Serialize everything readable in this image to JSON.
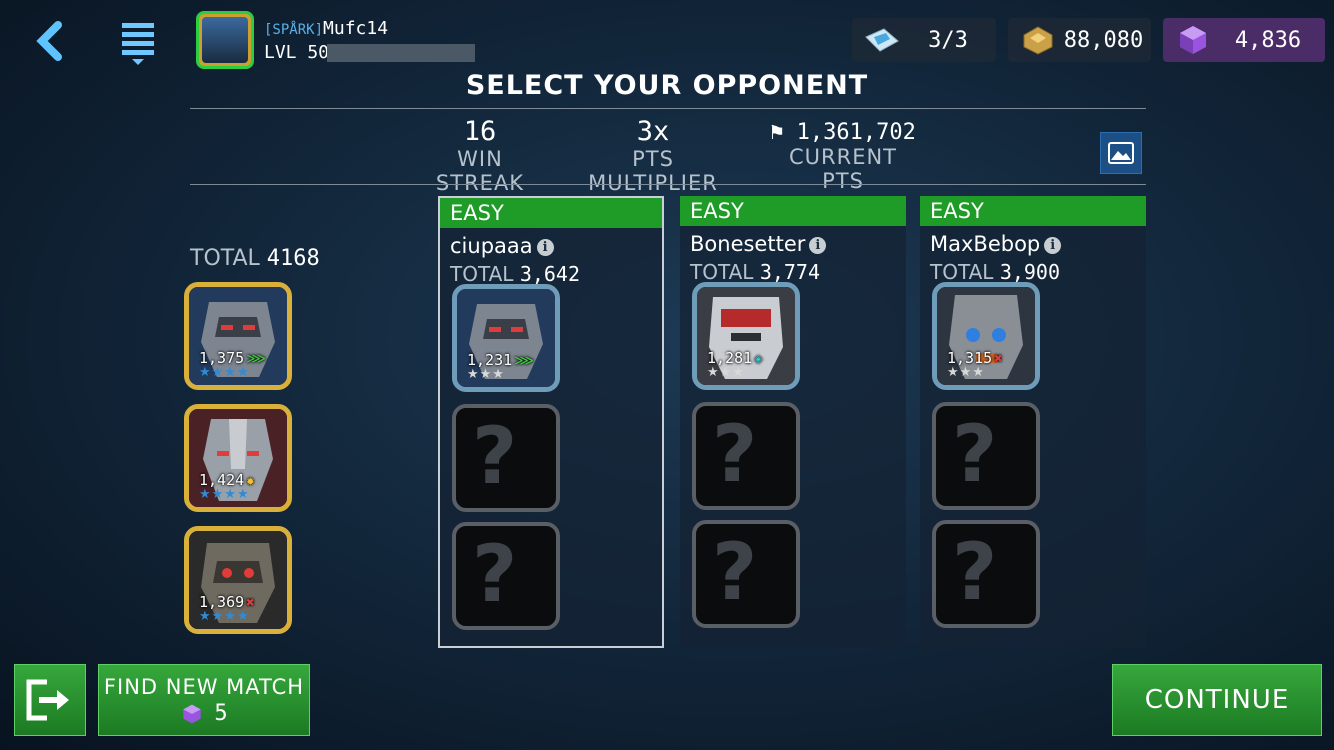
{
  "player": {
    "tag": "[SPÅRK]",
    "name": "Mufc14",
    "level": "LVL 50"
  },
  "resources": {
    "energy": "3/3",
    "gold": "88,080",
    "gems": "4,836"
  },
  "title": "SELECT YOUR OPPONENT",
  "stats": {
    "win_streak": {
      "value": "16",
      "label": "WIN STREAK"
    },
    "multiplier": {
      "value": "3x",
      "label": "PTS MULTIPLIER"
    },
    "current_pts": {
      "value": "1,361,702",
      "label": "CURRENT PTS"
    }
  },
  "my_team": {
    "total_label": "TOTAL",
    "total": "4168",
    "cards": [
      {
        "power": "1,375",
        "stars": "★★★★",
        "class_icon": "scout-class-icon"
      },
      {
        "power": "1,424",
        "stars": "★★★★",
        "class_icon": "warrior-class-icon"
      },
      {
        "power": "1,369",
        "stars": "★★★★",
        "class_icon": "demolisher-class-icon"
      }
    ]
  },
  "opponents": [
    {
      "difficulty": "EASY",
      "name": "ciupaaa",
      "total_label": "TOTAL",
      "total": "3,642",
      "power": "1,231",
      "stars": "★★★",
      "class_icon": "scout-class-icon",
      "unknown": "?"
    },
    {
      "difficulty": "EASY",
      "name": "Bonesetter",
      "total_label": "TOTAL",
      "total": "3,774",
      "power": "1,281",
      "stars": "★★★",
      "class_icon": "medic-class-icon",
      "unknown": "?"
    },
    {
      "difficulty": "EASY",
      "name": "MaxBebop",
      "total_label": "TOTAL",
      "total": "3,900",
      "power": "1,315",
      "stars": "★★★",
      "class_icon": "demolisher-class-icon",
      "unknown": "?"
    }
  ],
  "buttons": {
    "find_new_match": "FIND NEW MATCH",
    "find_cost": "5",
    "continue": "CONTINUE"
  },
  "colors": {
    "accent_green": "#1f9c27",
    "gold_frame": "#d9b03a",
    "gem_purple": "#7b3fb8"
  }
}
